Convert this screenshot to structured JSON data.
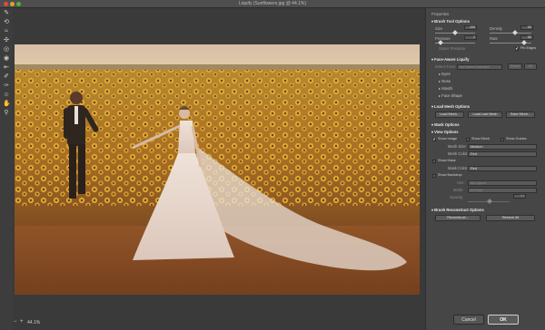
{
  "window": {
    "title": "Liquify (Sunflowers.jpg @ 44.1%)"
  },
  "toolbar": {
    "tools": [
      {
        "name": "forward-warp-tool-icon",
        "glyph": "✎"
      },
      {
        "name": "reconstruct-tool-icon",
        "glyph": "⟲"
      },
      {
        "name": "smooth-tool-icon",
        "glyph": "≈"
      },
      {
        "name": "twirl-tool-icon",
        "glyph": "✣"
      },
      {
        "name": "pucker-tool-icon",
        "glyph": "◎"
      },
      {
        "name": "bloat-tool-icon",
        "glyph": "◉"
      },
      {
        "name": "push-left-tool-icon",
        "glyph": "⇤"
      },
      {
        "name": "freeze-mask-tool-icon",
        "glyph": "✐"
      },
      {
        "name": "thaw-mask-tool-icon",
        "glyph": "✑"
      },
      {
        "name": "face-tool-icon",
        "glyph": "☺"
      },
      {
        "name": "hand-tool-icon",
        "glyph": "✋"
      },
      {
        "name": "zoom-tool-icon",
        "glyph": "⚲"
      }
    ]
  },
  "status": {
    "zoom_minus": "−",
    "zoom_plus": "+",
    "zoom_value": "44.1%"
  },
  "panel": {
    "title": "Properties",
    "brush_tool_options": "Brush Tool Options",
    "size_label": "Size",
    "size_value": "100",
    "density_label": "Density",
    "density_value": "50",
    "pressure_label": "Pressure",
    "pressure_value": "1",
    "rate_label": "Rate",
    "rate_value": "80",
    "stylus_pressure": "Stylus Pressure",
    "pin_edges": "Pin Edges",
    "face_aware": "Face-Aware Liquify",
    "select_face": "Select Face:",
    "no_faces": "No Faces Detected",
    "reset_label": "Reset",
    "all_label": "All",
    "eyes": "Eyes",
    "nose": "Nose",
    "mouth": "Mouth",
    "face_shape": "Face Shape",
    "load_mesh_options": "Load Mesh Options",
    "load_mesh": "Load Mesh...",
    "load_last_mesh": "Load Last Mesh",
    "save_mesh": "Save Mesh...",
    "mask_options": "Mask Options",
    "view_options": "View Options",
    "show_image": "Show Image",
    "show_mesh": "Show Mesh",
    "show_guides": "Show Guides",
    "mesh_size_label": "Mesh Size:",
    "mesh_size_value": "Medium",
    "mesh_color_label": "Mesh Color:",
    "mesh_color_value": "Red",
    "show_mask": "Show Mask",
    "mask_color_label": "Mask Color:",
    "mask_color_value": "Red",
    "show_backdrop": "Show Backdrop",
    "use_label": "Use:",
    "use_value": "All Layers",
    "mode_label": "Mode:",
    "mode_value": "In Front",
    "opacity_label": "Opacity:",
    "opacity_value": "50",
    "brush_reconstruct": "Brush Reconstruct Options",
    "reconstruct": "Reconstruct...",
    "restore_all": "Restore All",
    "cancel": "Cancel",
    "ok": "OK"
  },
  "checks": {
    "show_image": true,
    "show_mesh": false,
    "show_guides": false,
    "show_mask": false,
    "show_backdrop": false,
    "pin_edges": true
  },
  "colors": {
    "panel_bg": "#464646",
    "canvas_bg": "#3a3a3a",
    "accent": "#5a5a5a"
  }
}
